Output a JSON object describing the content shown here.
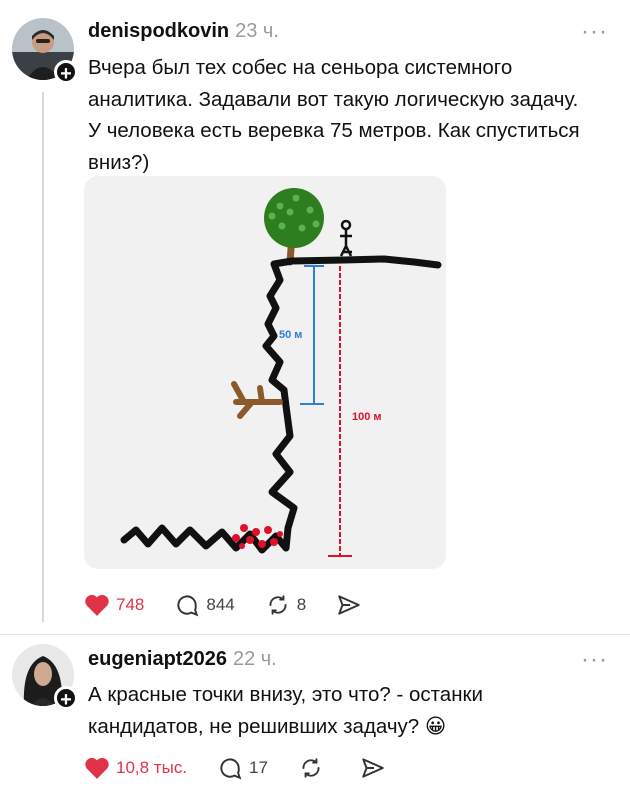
{
  "post": {
    "username": "denispodkovin",
    "time": "23 ч.",
    "more": "···",
    "text_lines": [
      "Вчера был тех собес на сеньора системного",
      "аналитика. Задавали вот такую логическую задачу.",
      "У человека есть веревка 75 метров. Как спуститься",
      "вниз?)"
    ],
    "drawing": {
      "label_50": "50 м",
      "label_100": "100 м",
      "colors": {
        "short_span": "#2f7fd6",
        "long_span": "#e0102a",
        "tree": "#2e7d1f",
        "trunk": "#8b5a2b",
        "dots": "#e0102a"
      }
    },
    "actions": {
      "likes": "748",
      "comments": "844",
      "reposts": "8"
    }
  },
  "comment": {
    "username": "eugeniapt2026",
    "time": "22 ч.",
    "more": "···",
    "text_lines": [
      "А красные точки внизу, это что? - останки",
      "кандидатов, не решивших задачу? 😀"
    ],
    "actions": {
      "likes": "10,8 тыс.",
      "comments": "17"
    }
  },
  "colors": {
    "like": "#e0334a",
    "muted": "#9a9a9a",
    "divider": "#e5e5e5"
  }
}
